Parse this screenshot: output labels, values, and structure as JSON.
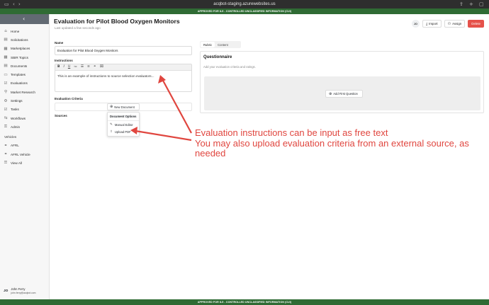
{
  "browser": {
    "url": "acqbot-staging.azurewebsites.us"
  },
  "banner": {
    "top": "APPROVED FOR IL5 - CONTROLLED UNCLASSIFIED INFORMATION (CUI)",
    "bottom": "APPROVED FOR IL5 - CONTROLLED UNCLASSIFIED INFORMATION (CUI)"
  },
  "sidebar": {
    "items": [
      {
        "label": "Home",
        "icon": "home-icon"
      },
      {
        "label": "Solicitations",
        "icon": "file-icon"
      },
      {
        "label": "Marketplaces",
        "icon": "store-icon"
      },
      {
        "label": "SBIR Topics",
        "icon": "grid-icon"
      },
      {
        "label": "Documents",
        "icon": "document-icon"
      },
      {
        "label": "Templates",
        "icon": "template-icon"
      },
      {
        "label": "Evaluations",
        "icon": "check-icon"
      },
      {
        "label": "Market Research",
        "icon": "research-icon"
      },
      {
        "label": "Settings",
        "icon": "gear-icon"
      },
      {
        "label": "Tasks",
        "icon": "tasks-icon"
      },
      {
        "label": "Workflows",
        "icon": "workflow-icon"
      },
      {
        "label": "Admin",
        "icon": "admin-icon"
      }
    ],
    "vehicles_heading": "Vehicles",
    "vehicles": [
      {
        "label": "AFRL",
        "icon": "vehicle-icon"
      },
      {
        "label": "AFRL Vehicle",
        "icon": "vehicle-icon"
      },
      {
        "label": "View All",
        "icon": "list-icon"
      }
    ],
    "user": {
      "initials": "JO",
      "name": "John Ferry",
      "email": "john.ferry@acqbot.com"
    }
  },
  "header": {
    "title": "Evaluation for Pilot Blood Oxygen Monitors",
    "subtitle": "Last updated a few seconds ago",
    "avatar": "JO",
    "import_label": "Import",
    "assign_label": "Assign",
    "delete_label": "Delete",
    "delete_color": "#e5514a"
  },
  "form": {
    "name_label": "Name",
    "name_value": "Evaluation for Pilot Blood Oxygen Monitors",
    "instructions_label": "Instructions",
    "instructions_text": "This is an example of instructions to source selection evaluators...",
    "criteria_label": "Evaluation Criteria",
    "sources_label": "Sources",
    "new_document_label": "New Document",
    "doc_options_heading": "Document Options",
    "doc_options": [
      "Manual Editor",
      "Upload PDF"
    ]
  },
  "toolbar": [
    "B",
    "I",
    "U",
    "list-ordered",
    "list-bullet",
    "align",
    "link",
    "clear"
  ],
  "right": {
    "tabs": [
      "Rubric",
      "Content"
    ],
    "active_tab": 0,
    "questionnaire_title": "Questionnaire",
    "questionnaire_sub": "Add your evaluation criteria and ratings.",
    "add_question_label": "Add First Question"
  },
  "annotation": {
    "line1": "Evaluation instructions can be input as free text",
    "line2": "You may also upload evaluation criteria from an external source, as needed",
    "color": "#e0463f"
  }
}
